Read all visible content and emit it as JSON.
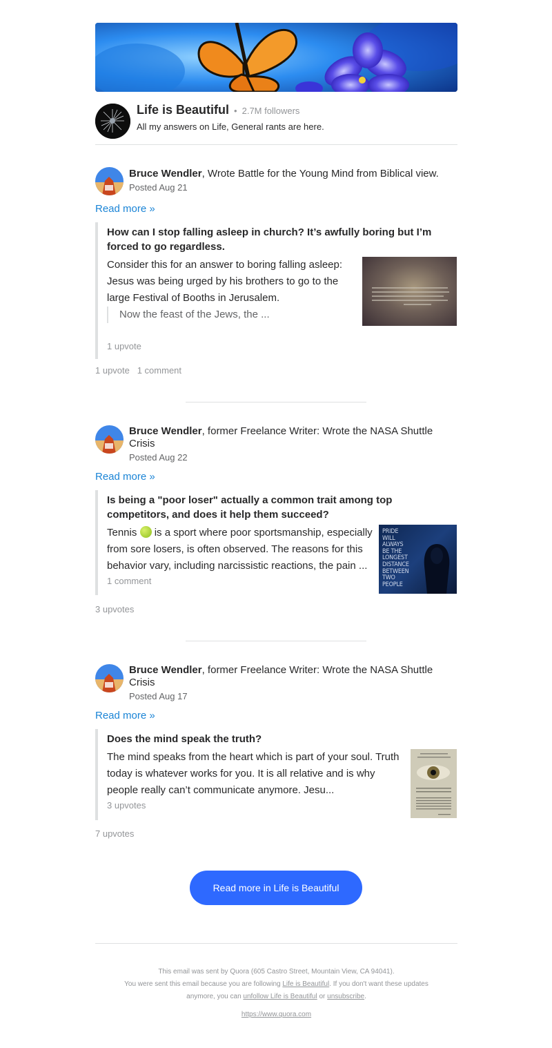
{
  "space": {
    "name": "Life is Beautiful",
    "separator": "•",
    "followers": "2.7M followers",
    "description": "All my answers on Life, General rants are here."
  },
  "posts": [
    {
      "author": "Bruce Wendler",
      "credential": ", Wrote Battle for the Young Mind from Biblical view.",
      "posted": "Posted Aug 21",
      "read_more": "Read more »",
      "question": "How can I stop falling asleep in church? It’s awfully boring but I’m forced to go regardless.",
      "body": "Consider this for an answer to boring falling asleep: Jesus was being urged by his brothers to go to the large Festival of Booths in Jerusalem.",
      "inner_quote": "Now the feast of the Jews, the ...",
      "inner_meta": "1 upvote",
      "outer_meta": "1 upvote   1 comment"
    },
    {
      "author": "Bruce Wendler",
      "credential": ", former Freelance Writer: Wrote the NASA Shuttle Crisis",
      "posted": "Posted Aug 22",
      "read_more": "Read more »",
      "question": "Is being a \"poor loser\" actually a common trait among top competitors, and does it help them succeed?",
      "body_pre": "Tennis",
      "body": "is a sport where poor sportsmanship, especially from sore losers, is often observed. The reasons for this behavior vary, including narcissistic reactions, the pain ...",
      "inner_meta": "1 comment",
      "outer_meta": "3 upvotes",
      "thumb_text": "PRIDE WILL ALWAYS BE THE LONGEST DISTANCE BETWEEN TWO PEOPLE"
    },
    {
      "author": "Bruce Wendler",
      "credential": ", former Freelance Writer: Wrote the NASA Shuttle Crisis",
      "posted": "Posted Aug 17",
      "read_more": "Read more »",
      "question": "Does the mind speak the truth?",
      "body": "The mind speaks from the heart which is part of your soul. Truth today is whatever works for you. It is all relative and is why people really can’t communicate anymore. Jesu...",
      "inner_meta": "3 upvotes",
      "outer_meta": "7 upvotes"
    }
  ],
  "cta": {
    "label": "Read more in Life is Beautiful"
  },
  "footer": {
    "line1": "This email was sent by Quora (605 Castro Street, Mountain View, CA 94041).",
    "line2_pre": "You were sent this email because you are following ",
    "line2_link": "Life is Beautiful",
    "line2_post": ". If you don't want these updates",
    "line3_pre": "anymore, you can ",
    "unfollow_link": "unfollow Life is Beautiful",
    "line3_mid": " or ",
    "unsubscribe_link": "unsubscribe",
    "line3_post": ".",
    "url": "https://www.quora.com"
  },
  "colors": {
    "cta": "#2e69ff",
    "link": "#1a84d6",
    "muted": "#939598"
  }
}
